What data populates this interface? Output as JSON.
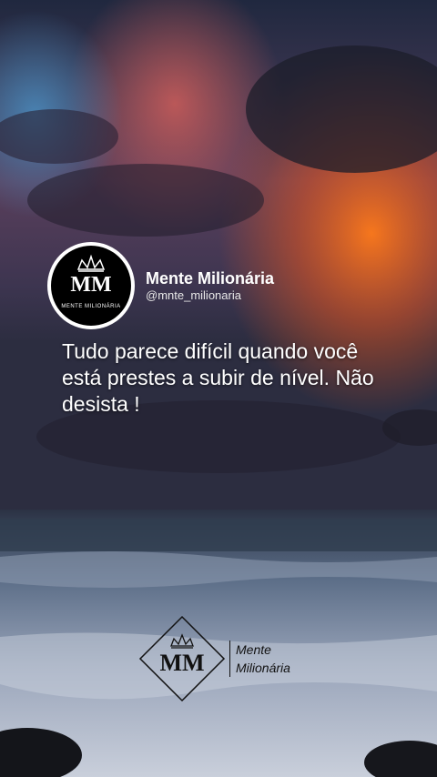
{
  "account": {
    "name": "Mente Milionária",
    "handle": "@mnte_milionaria",
    "avatar_initials": "MM",
    "avatar_caption": "MENTE MILIONÁRIA"
  },
  "post": {
    "quote": "Tudo parece difícil quando você está prestes a subir de nível. Não desista !"
  },
  "watermark": {
    "initials": "MM",
    "line1": "Mente",
    "line2": "Milionária"
  },
  "colors": {
    "sky_top": "#1f2a44",
    "sunset_orange": "#ff6a1a",
    "sea": "#4a5a7a"
  },
  "icons": [
    "crown-icon",
    "diamond-frame-icon"
  ]
}
